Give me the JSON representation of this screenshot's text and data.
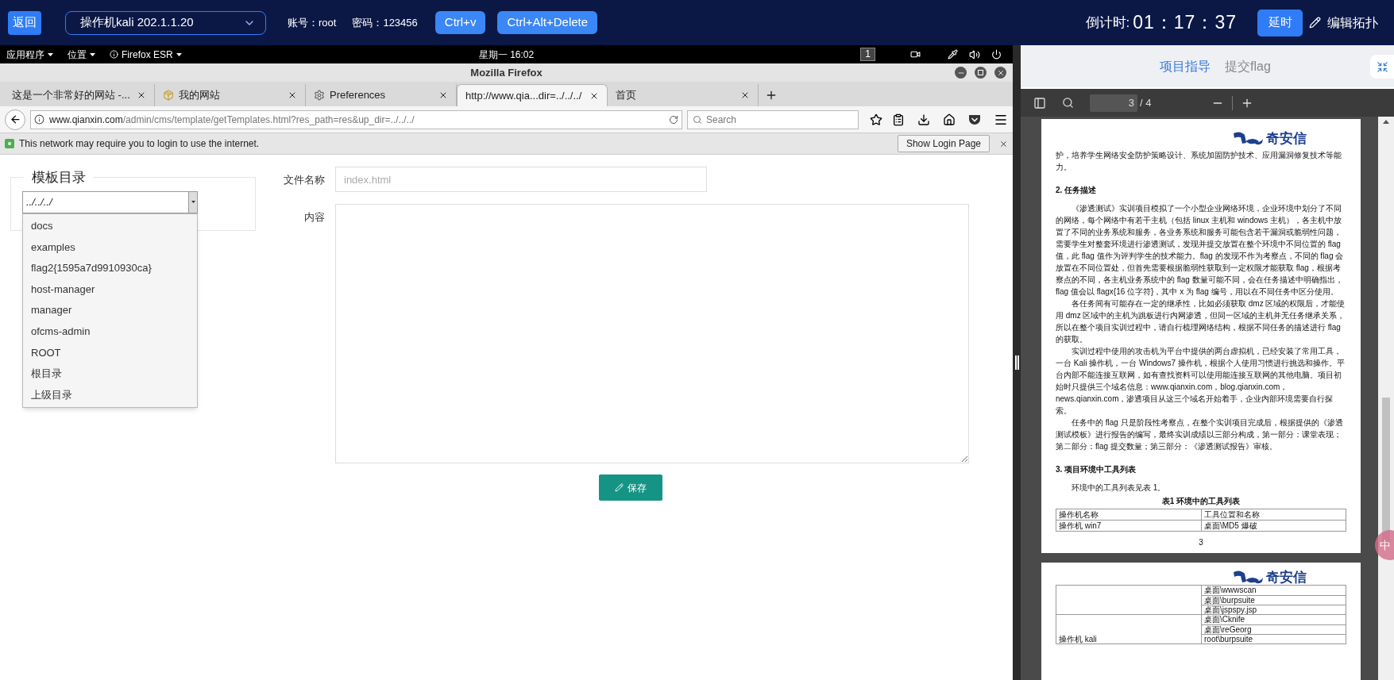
{
  "top_bar": {
    "back_button": "返回",
    "machine_select": "操作机kali 202.1.1.20",
    "account": "账号：root",
    "password": "密码：123456",
    "buttons": [
      "Ctrl+v",
      "Ctrl+Alt+Delete"
    ],
    "countdown_label": "倒计时:",
    "countdown": "01：17：37",
    "extend_button": "延时",
    "edit_topology": "编辑拓扑"
  },
  "desktop_panel": {
    "menus": [
      "应用程序",
      "位置",
      "Firefox ESR"
    ],
    "clock": "星期一 16:02",
    "workspace": "1"
  },
  "browser": {
    "title": "Mozilla Firefox",
    "tabs": [
      {
        "label": "这是一个非常好的网站 -...",
        "selected": false,
        "kind": "plain"
      },
      {
        "label": "我的网站",
        "selected": false,
        "kind": "package"
      },
      {
        "label": "Preferences",
        "selected": false,
        "kind": "gear"
      },
      {
        "label": "http://www.qia...dir=../../../",
        "selected": true,
        "kind": "plain"
      },
      {
        "label": "首页",
        "selected": false,
        "kind": "plain"
      }
    ],
    "url_host": "www.qianxin.com",
    "url_path": "/admin/cms/template/getTemplates.html?res_path=res&up_dir=../../../",
    "search_placeholder": "Search",
    "notification": {
      "message": "This network may require you to login to use the internet.",
      "button": "Show Login Page"
    }
  },
  "page": {
    "template_dir": {
      "legend": "模板目录",
      "select_value": "../../../",
      "expanded": true,
      "options": [
        "docs",
        "examples",
        "flag2{1595a7d9910930ca}",
        "host-manager",
        "manager",
        "ofcms-admin",
        "ROOT",
        "根目录",
        "上级目录"
      ]
    },
    "file_name": {
      "label": "文件名称",
      "placeholder": "index.html"
    },
    "content": {
      "label": "内容"
    },
    "save_button": "保存"
  },
  "guide_panel": {
    "tabs": [
      {
        "label": "项目指导",
        "selected": true
      },
      {
        "label": "提交flag",
        "selected": false
      }
    ],
    "pdf": {
      "page": "3",
      "total": "/ 4",
      "ime": "中",
      "pages": [
        {
          "logo": "奇安信",
          "blocks": [
            {
              "kind": "para",
              "text": "护，培养学生网络安全防护策略设计、系统加固防护技术、应用漏洞修复技术等能力。"
            },
            {
              "kind": "heading",
              "text": "2. 任务描述"
            },
            {
              "kind": "indented",
              "text": "《渗透测试》实训项目模拟了一个小型企业网络环境，企业环境中划分了不同的网络，每个网络中有若干主机（包括 linux 主机和 windows 主机），各主机中放置了不同的业务系统和服务，各业务系统和服务可能包含若干漏洞或脆弱性问题，需要学生对整套环境进行渗透测试，发现并提交放置在整个环境中不同位置的 flag 值，此 flag 值作为评判学生的技术能力。flag 的发现不作为考察点，不同的 flag 会放置在不同位置处，但首先需要根据脆弱性获取到一定权限才能获取 flag，根据考察点的不同，各主机业务系统中的 flag 数量可能不同，会在任务描述中明确指出，flag 值会以 flagx{16 位字符}，其中 x 为 flag 编号，用以在不同任务中区分使用。"
            },
            {
              "kind": "indented",
              "text": "各任务间有可能存在一定的继承性，比如必须获取 dmz 区域的权限后，才能使用 dmz 区域中的主机为跳板进行内网渗透，但同一区域的主机并无任务继承关系，所以在整个项目实训过程中，请自行梳理网络结构，根据不同任务的描述进行 flag 的获取。"
            },
            {
              "kind": "indented",
              "text": "实训过程中使用的攻击机为平台中提供的两台虚拟机，已经安装了常用工具，一台 Kali 操作机，一台 Windows7 操作机，根据个人使用习惯进行挑选和操作。平台内部不能连接互联网，如有查找资料可以使用能连接互联网的其他电脑。项目初始时只提供三个域名信息：www.qianxin.com，blog.qianxin.com，news.qianxin.com，渗透项目从这三个域名开始着手，企业内部环境需要自行探索。"
            },
            {
              "kind": "indented",
              "text": "任务中的 flag 只是阶段性考察点，在整个实训项目完成后，根据提供的《渗透测试模板》进行报告的编写，最终实训成绩以三部分构成，第一部分：课堂表现；第二部分：flag 提交数量；第三部分：《渗透测试报告》审核。"
            },
            {
              "kind": "heading",
              "text": "3. 项目环境中工具列表"
            },
            {
              "kind": "indented",
              "text": "环境中的工具列表见表 1。"
            },
            {
              "kind": "caption",
              "text": "表1 环境中的工具列表"
            },
            {
              "kind": "table",
              "rows": [
                [
                  "操作机名称",
                  "工具位置和名称"
                ],
                [
                  "操作机 win7",
                  "桌面\\MD5 爆破"
                ]
              ]
            },
            {
              "kind": "page_number",
              "text": "3"
            }
          ]
        },
        {
          "logo": "奇安信",
          "blocks": [
            {
              "kind": "group_table",
              "groups": [
                {
                  "tools": [
                    "桌面\\wwwscan",
                    "桌面\\burpsuite",
                    "桌面\\jspspy.jsp"
                  ]
                },
                {
                  "name": "操作机 kali",
                  "tools": [
                    "桌面\\Cknife",
                    "桌面\\reGeorg",
                    "root\\burpsuite"
                  ]
                }
              ]
            }
          ]
        }
      ]
    }
  }
}
